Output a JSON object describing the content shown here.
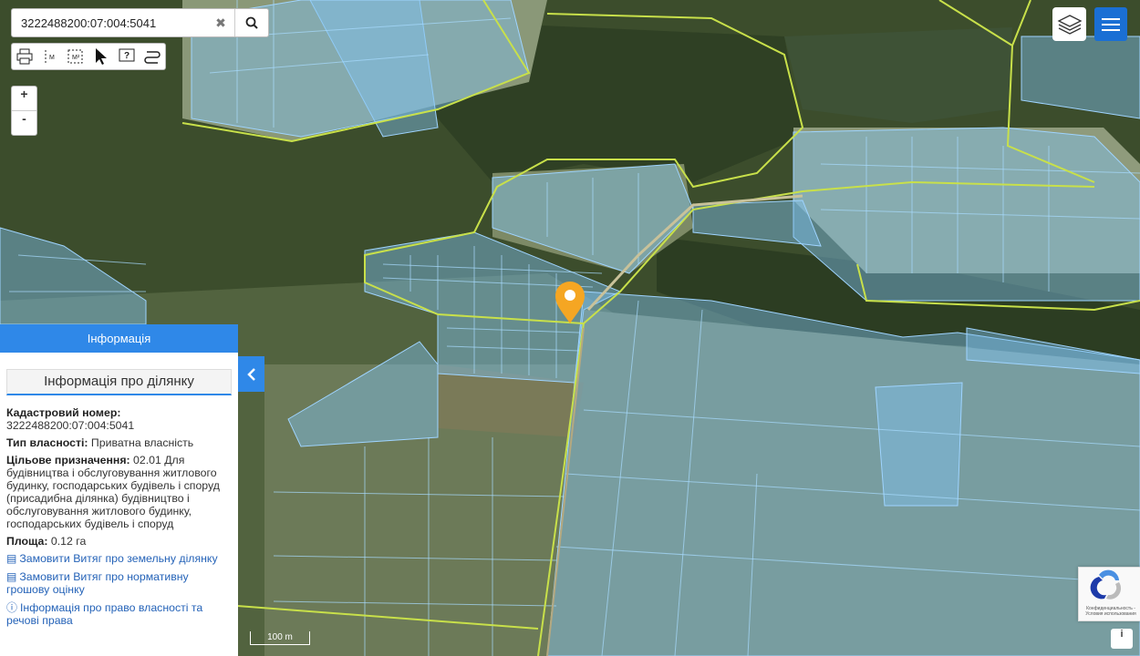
{
  "search": {
    "value": "3222488200:07:004:5041"
  },
  "zoom": {
    "in_label": "+",
    "out_label": "-"
  },
  "panel": {
    "header": "Інформація",
    "subtitle": "Інформація про ділянку",
    "cadastral_label": "Кадастровий номер:",
    "cadastral_value": "3222488200:07:004:5041",
    "ownership_label": "Тип власності:",
    "ownership_value": "Приватна власність",
    "purpose_label": "Цільове призначення:",
    "purpose_value": "02.01 Для будівництва і обслуговування житлового будинку, господарських будівель і споруд (присадибна ділянка) будівництво і обслуговування житлового будинку, господарських будівель і споруд",
    "area_label": "Площа:",
    "area_value": "0.12 га",
    "links": [
      "Замовити Витяг про земельну ділянку",
      "Замовити Витяг про нормативну грошову оцінку",
      "Інформація про право власності та речові права"
    ]
  },
  "scale": {
    "label": "100 m"
  },
  "recaptcha": {
    "text": "Конфиденциальность - Условия использования"
  },
  "info_button": {
    "label": "i"
  },
  "colors": {
    "accent": "#2f88e8",
    "parcel": "#7fc2f0",
    "boundary": "#c8e04a",
    "marker": "#f5a623"
  },
  "icons": [
    "search-icon",
    "close-icon",
    "print-icon",
    "ruler-icon",
    "area-measure-icon",
    "cursor-icon",
    "help-icon",
    "route-icon",
    "layers-icon",
    "menu-icon",
    "chevron-left-icon",
    "location-pin-icon",
    "document-icon",
    "info-icon"
  ]
}
